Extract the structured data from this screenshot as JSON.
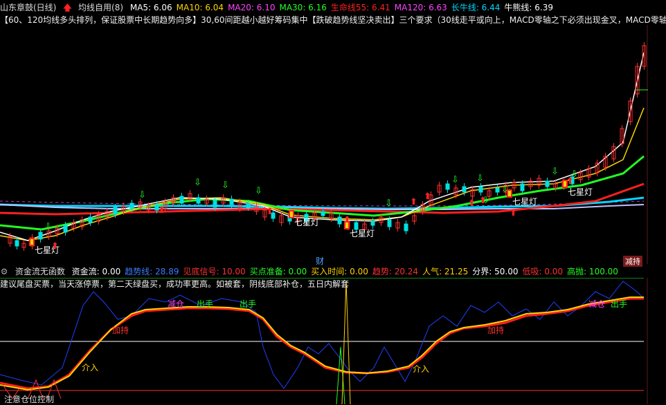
{
  "title_bar": {
    "stock_name": "山东章鼓(日线)",
    "indicator_name": "均线自用(8)",
    "ma_values": [
      {
        "label": "MA5: 6.06",
        "color": "#ffffff"
      },
      {
        "label": "MA10: 6.04",
        "color": "#ffd400"
      },
      {
        "label": "MA20: 6.10",
        "color": "#ff44ff"
      },
      {
        "label": "MA30: 6.16",
        "color": "#22ff22"
      },
      {
        "label": "生命线55: 6.41",
        "color": "#ff2020"
      },
      {
        "label": "MA120: 6.63",
        "color": "#ff44ff"
      },
      {
        "label": "长牛线: 6.44",
        "color": "#00d7ff"
      },
      {
        "label": "牛熊线: 6.39",
        "color": "#ffffff"
      }
    ]
  },
  "description": "【60、120均线多头排列，保证股票中长期趋势向多】30,60间距越小越好筹码集中【跌破趋势线坚决卖出】三个要求（30线走平或向上，MACD零轴之下必须出现金叉，MACD零轴之",
  "main_chart": {
    "labels": [
      {
        "text": "七星灯"
      },
      {
        "text": "七星灯"
      },
      {
        "text": "七星灯"
      },
      {
        "text": "七星灯"
      },
      {
        "text": "七星灯"
      }
    ],
    "finance_tab": "财",
    "sell_tab": "减持"
  },
  "indicator_panel": {
    "name": "资金流无函数",
    "values": [
      {
        "label": "资金流: 0.00",
        "color": "#ffffff"
      },
      {
        "label": "趋势线: 28.89",
        "color": "#3a7bff"
      },
      {
        "label": "见底信号: 10.00",
        "color": "#ff3030"
      },
      {
        "label": "买点准备: 0.00",
        "color": "#22ff22"
      },
      {
        "label": "买入时间: 0.00",
        "color": "#ffd400"
      },
      {
        "label": "趋势: 20.24",
        "color": "#ff3030"
      },
      {
        "label": "人气: 21.25",
        "color": "#ffd400"
      },
      {
        "label": "分界: 50.00",
        "color": "#ffffff"
      },
      {
        "label": "低吸: 0.00",
        "color": "#ff3030"
      },
      {
        "label": "高抛: 100.00",
        "color": "#22ff22"
      }
    ],
    "advice": "建议尾盘买票，当天涨停票，第二天绿盘买，成功率更高。如被套，阴线底部补仓，五日内解套",
    "markers": [
      {
        "text": "减仓",
        "color": "#ff44ff"
      },
      {
        "text": "出手",
        "color": "#22ff22"
      },
      {
        "text": "出手",
        "color": "#22ff22"
      },
      {
        "text": "加持",
        "color": "#ff3030"
      },
      {
        "text": "介入",
        "color": "#ffd400"
      },
      {
        "text": "加持",
        "color": "#ff3030"
      },
      {
        "text": "介入",
        "color": "#ffd400"
      },
      {
        "text": "减仓",
        "color": "#ff44ff"
      },
      {
        "text": "出手",
        "color": "#22ff22"
      }
    ],
    "footer_note": "注意仓位控制"
  }
}
